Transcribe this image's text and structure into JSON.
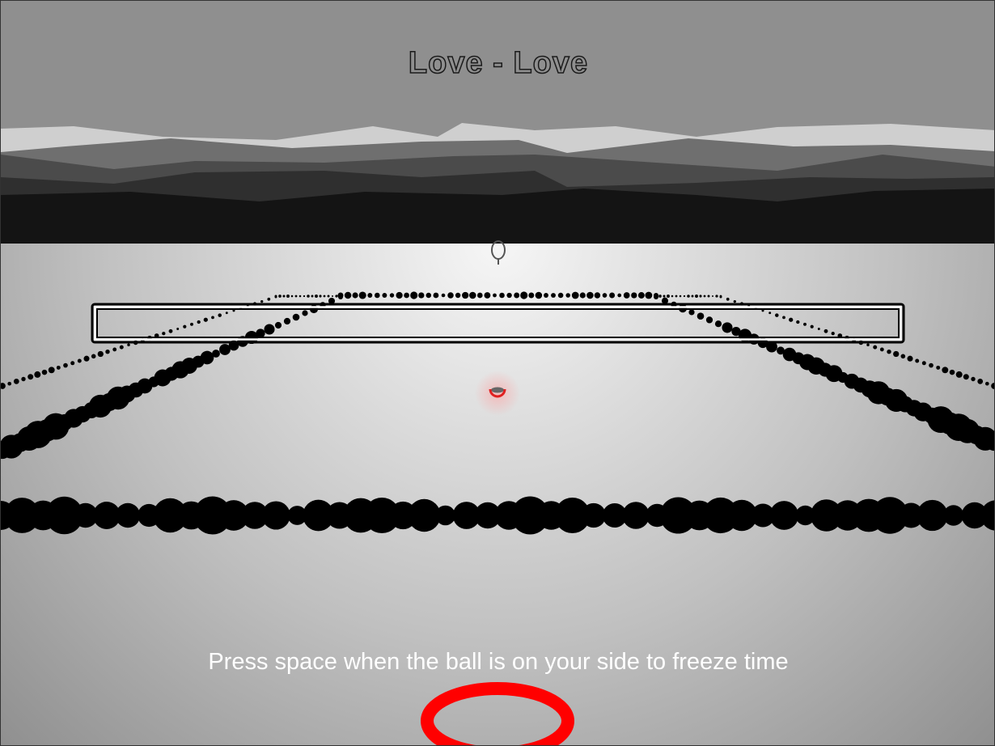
{
  "score": {
    "text": "Love - Love"
  },
  "hint": {
    "text": "Press space when the ball is on your side to freeze time"
  },
  "colors": {
    "sky": "#8f8f8f",
    "mountains": [
      "#cfcfcf",
      "#6e6e6e",
      "#4a4a4a",
      "#2e2e2e",
      "#141414"
    ],
    "court_center": "#f4f4f4",
    "court_edge": "#9a9a9a",
    "lines": "#000000",
    "net_border": "#000000",
    "net_outline": "#ffffff",
    "ball": "#e02020",
    "player_racket": "#ff0000",
    "opponent_racket": "#555555"
  },
  "icons": {
    "opponent": "racket-icon",
    "ball": "ball-icon",
    "player": "racket-icon"
  }
}
